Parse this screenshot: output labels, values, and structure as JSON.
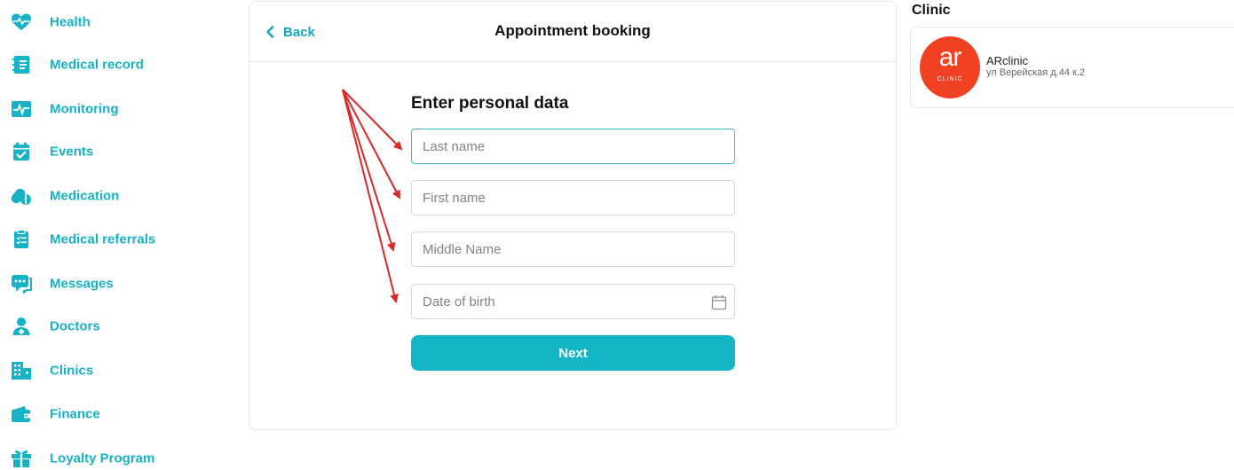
{
  "sidebar": {
    "items": [
      {
        "label": "Health",
        "icon": "heart-pulse-icon"
      },
      {
        "label": "Medical record",
        "icon": "notebook-icon"
      },
      {
        "label": "Monitoring",
        "icon": "monitor-pulse-icon"
      },
      {
        "label": "Events",
        "icon": "calendar-check-icon"
      },
      {
        "label": "Medication",
        "icon": "pills-icon"
      },
      {
        "label": "Medical referrals",
        "icon": "clipboard-list-icon"
      },
      {
        "label": "Messages",
        "icon": "chat-bubble-icon"
      },
      {
        "label": "Doctors",
        "icon": "doctor-icon"
      },
      {
        "label": "Clinics",
        "icon": "building-icon"
      },
      {
        "label": "Finance",
        "icon": "wallet-icon"
      },
      {
        "label": "Loyalty Program",
        "icon": "gift-icon"
      }
    ]
  },
  "booking": {
    "back_label": "Back",
    "title": "Appointment booking",
    "heading": "Enter personal data",
    "fields": {
      "last_name": {
        "placeholder": "Last name",
        "value": ""
      },
      "first_name": {
        "placeholder": "First name",
        "value": ""
      },
      "middle_name": {
        "placeholder": "Middle Name",
        "value": ""
      },
      "date_of_birth": {
        "placeholder": "Date of birth",
        "value": ""
      }
    },
    "next_label": "Next"
  },
  "clinic": {
    "heading": "Clinic",
    "logo_text": "ar",
    "logo_sub": "CLINIC",
    "name": "ARclinic",
    "address": "ул Верейская д.44 к.2"
  },
  "colors": {
    "accent": "#13b5c6",
    "sidebar_text": "#17b2c4",
    "clinic_logo": "#f24122",
    "annotation_arrow": "#d42a2a"
  }
}
